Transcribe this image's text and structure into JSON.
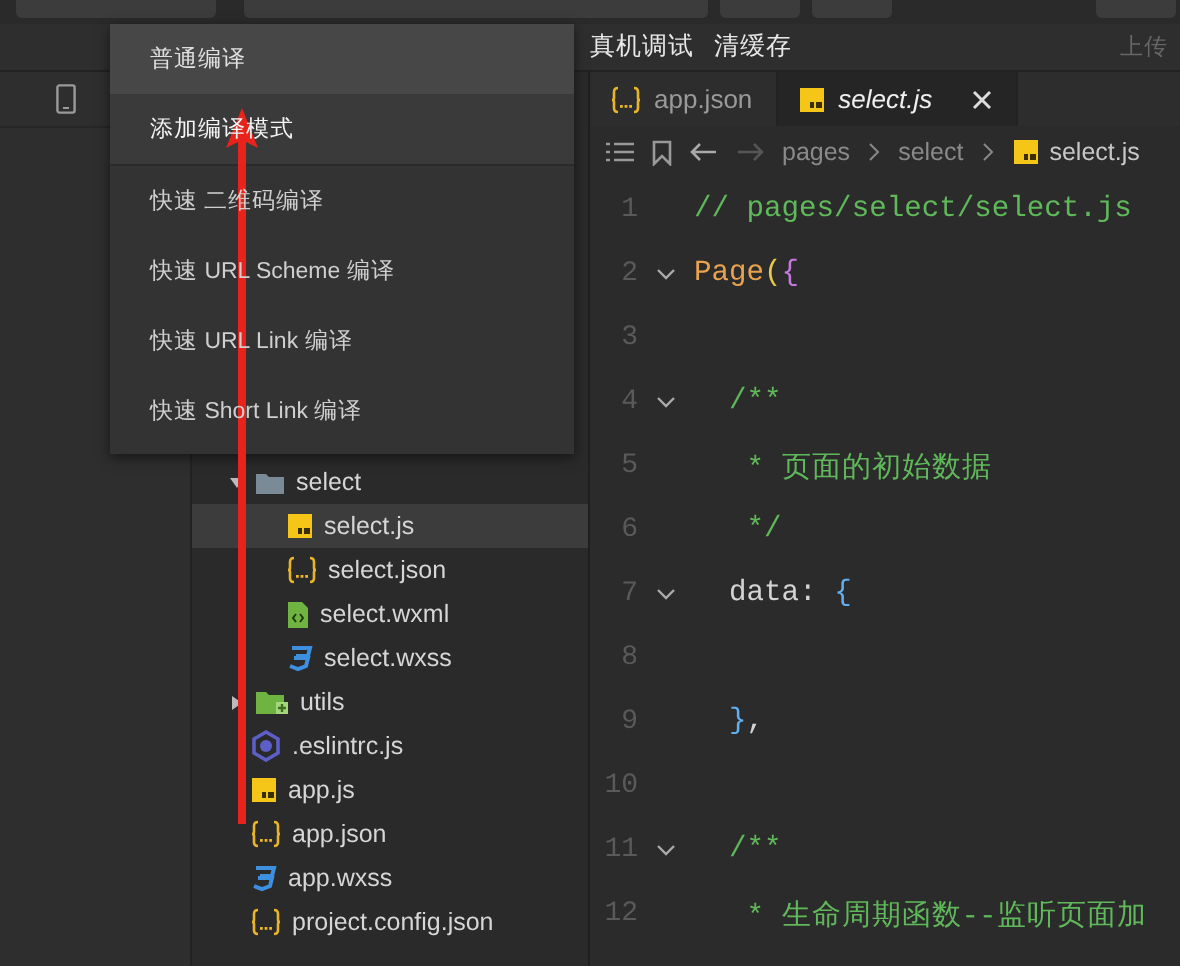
{
  "toolbar": {
    "actions": [
      "真机调试",
      "清缓存"
    ],
    "upload": "上传"
  },
  "compile_menu": {
    "items": [
      {
        "label": "普通编译",
        "kind": "mode"
      },
      {
        "label": "添加编译模式",
        "kind": "add"
      },
      {
        "label": "快速 二维码编译",
        "kind": "quick"
      },
      {
        "label": "快速 URL Scheme 编译",
        "kind": "quick"
      },
      {
        "label": "快速 URL Link 编译",
        "kind": "quick"
      },
      {
        "label": "快速 Short Link 编译",
        "kind": "quick"
      }
    ]
  },
  "file_tree": [
    {
      "name": "select",
      "kind": "folder",
      "expanded": true,
      "selected": false,
      "children": [
        {
          "name": "select.js",
          "kind": "js",
          "selected": true
        },
        {
          "name": "select.json",
          "kind": "json",
          "selected": false
        },
        {
          "name": "select.wxml",
          "kind": "wxml",
          "selected": false
        },
        {
          "name": "select.wxss",
          "kind": "wxss",
          "selected": false
        }
      ]
    },
    {
      "name": "utils",
      "kind": "folder",
      "expanded": false,
      "selected": false
    },
    {
      "name": ".eslintrc.js",
      "kind": "eslint",
      "selected": false
    },
    {
      "name": "app.js",
      "kind": "js",
      "selected": false
    },
    {
      "name": "app.json",
      "kind": "json",
      "selected": false
    },
    {
      "name": "app.wxss",
      "kind": "wxss",
      "selected": false
    },
    {
      "name": "project.config.json",
      "kind": "json",
      "selected": false
    }
  ],
  "tabs": [
    {
      "label": "app.json",
      "kind": "json",
      "selected": false
    },
    {
      "label": "select.js",
      "kind": "js",
      "selected": true
    }
  ],
  "breadcrumb": [
    {
      "label": "pages",
      "kind": "folder"
    },
    {
      "label": "select",
      "kind": "folder"
    },
    {
      "label": "select.js",
      "kind": "js"
    }
  ],
  "code_lines": [
    {
      "number": "1",
      "fold": false,
      "tokens": [
        {
          "text": "// pages/select/select.js",
          "kind": "comment"
        }
      ]
    },
    {
      "number": "2",
      "fold": true,
      "tokens": [
        {
          "text": "Page",
          "kind": "function"
        },
        {
          "text": "(",
          "kind": "paren"
        },
        {
          "text": "{",
          "kind": "brace"
        }
      ]
    },
    {
      "number": "3",
      "fold": false
    },
    {
      "number": "4",
      "fold": true,
      "tokens": [
        {
          "text": "  /**",
          "kind": "comment"
        }
      ]
    },
    {
      "number": "5",
      "fold": false,
      "tokens": [
        {
          "text": "   * 页面的初始数据",
          "kind": "comment"
        }
      ]
    },
    {
      "number": "6",
      "fold": false,
      "tokens": [
        {
          "text": "   */",
          "kind": "comment"
        }
      ]
    },
    {
      "number": "7",
      "fold": true,
      "tokens": [
        {
          "text": "  data: ",
          "kind": "plain"
        },
        {
          "text": "{",
          "kind": "inner"
        }
      ]
    },
    {
      "number": "8",
      "fold": false
    },
    {
      "number": "9",
      "fold": false,
      "tokens": [
        {
          "text": "  }",
          "kind": "inner"
        },
        {
          "text": ",",
          "kind": "plain"
        }
      ]
    },
    {
      "number": "10",
      "fold": false
    },
    {
      "number": "11",
      "fold": true,
      "tokens": [
        {
          "text": "  /**",
          "kind": "comment"
        }
      ]
    },
    {
      "number": "12",
      "fold": false,
      "tokens": [
        {
          "text": "   * 生命周期函数--监听页面加",
          "kind": "comment"
        }
      ]
    }
  ]
}
